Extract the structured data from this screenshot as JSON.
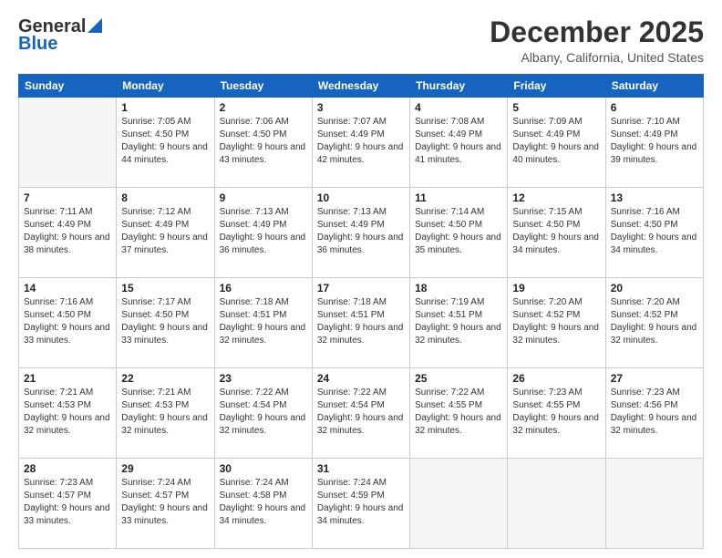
{
  "logo": {
    "general": "General",
    "blue": "Blue"
  },
  "header": {
    "month": "December 2025",
    "location": "Albany, California, United States"
  },
  "days_of_week": [
    "Sunday",
    "Monday",
    "Tuesday",
    "Wednesday",
    "Thursday",
    "Friday",
    "Saturday"
  ],
  "weeks": [
    [
      {
        "num": "",
        "empty": true
      },
      {
        "num": "1",
        "sunrise": "7:05 AM",
        "sunset": "4:50 PM",
        "daylight": "9 hours and 44 minutes."
      },
      {
        "num": "2",
        "sunrise": "7:06 AM",
        "sunset": "4:50 PM",
        "daylight": "9 hours and 43 minutes."
      },
      {
        "num": "3",
        "sunrise": "7:07 AM",
        "sunset": "4:49 PM",
        "daylight": "9 hours and 42 minutes."
      },
      {
        "num": "4",
        "sunrise": "7:08 AM",
        "sunset": "4:49 PM",
        "daylight": "9 hours and 41 minutes."
      },
      {
        "num": "5",
        "sunrise": "7:09 AM",
        "sunset": "4:49 PM",
        "daylight": "9 hours and 40 minutes."
      },
      {
        "num": "6",
        "sunrise": "7:10 AM",
        "sunset": "4:49 PM",
        "daylight": "9 hours and 39 minutes."
      }
    ],
    [
      {
        "num": "7",
        "sunrise": "7:11 AM",
        "sunset": "4:49 PM",
        "daylight": "9 hours and 38 minutes."
      },
      {
        "num": "8",
        "sunrise": "7:12 AM",
        "sunset": "4:49 PM",
        "daylight": "9 hours and 37 minutes."
      },
      {
        "num": "9",
        "sunrise": "7:13 AM",
        "sunset": "4:49 PM",
        "daylight": "9 hours and 36 minutes."
      },
      {
        "num": "10",
        "sunrise": "7:13 AM",
        "sunset": "4:49 PM",
        "daylight": "9 hours and 36 minutes."
      },
      {
        "num": "11",
        "sunrise": "7:14 AM",
        "sunset": "4:50 PM",
        "daylight": "9 hours and 35 minutes."
      },
      {
        "num": "12",
        "sunrise": "7:15 AM",
        "sunset": "4:50 PM",
        "daylight": "9 hours and 34 minutes."
      },
      {
        "num": "13",
        "sunrise": "7:16 AM",
        "sunset": "4:50 PM",
        "daylight": "9 hours and 34 minutes."
      }
    ],
    [
      {
        "num": "14",
        "sunrise": "7:16 AM",
        "sunset": "4:50 PM",
        "daylight": "9 hours and 33 minutes."
      },
      {
        "num": "15",
        "sunrise": "7:17 AM",
        "sunset": "4:50 PM",
        "daylight": "9 hours and 33 minutes."
      },
      {
        "num": "16",
        "sunrise": "7:18 AM",
        "sunset": "4:51 PM",
        "daylight": "9 hours and 32 minutes."
      },
      {
        "num": "17",
        "sunrise": "7:18 AM",
        "sunset": "4:51 PM",
        "daylight": "9 hours and 32 minutes."
      },
      {
        "num": "18",
        "sunrise": "7:19 AM",
        "sunset": "4:51 PM",
        "daylight": "9 hours and 32 minutes."
      },
      {
        "num": "19",
        "sunrise": "7:20 AM",
        "sunset": "4:52 PM",
        "daylight": "9 hours and 32 minutes."
      },
      {
        "num": "20",
        "sunrise": "7:20 AM",
        "sunset": "4:52 PM",
        "daylight": "9 hours and 32 minutes."
      }
    ],
    [
      {
        "num": "21",
        "sunrise": "7:21 AM",
        "sunset": "4:53 PM",
        "daylight": "9 hours and 32 minutes."
      },
      {
        "num": "22",
        "sunrise": "7:21 AM",
        "sunset": "4:53 PM",
        "daylight": "9 hours and 32 minutes."
      },
      {
        "num": "23",
        "sunrise": "7:22 AM",
        "sunset": "4:54 PM",
        "daylight": "9 hours and 32 minutes."
      },
      {
        "num": "24",
        "sunrise": "7:22 AM",
        "sunset": "4:54 PM",
        "daylight": "9 hours and 32 minutes."
      },
      {
        "num": "25",
        "sunrise": "7:22 AM",
        "sunset": "4:55 PM",
        "daylight": "9 hours and 32 minutes."
      },
      {
        "num": "26",
        "sunrise": "7:23 AM",
        "sunset": "4:55 PM",
        "daylight": "9 hours and 32 minutes."
      },
      {
        "num": "27",
        "sunrise": "7:23 AM",
        "sunset": "4:56 PM",
        "daylight": "9 hours and 32 minutes."
      }
    ],
    [
      {
        "num": "28",
        "sunrise": "7:23 AM",
        "sunset": "4:57 PM",
        "daylight": "9 hours and 33 minutes."
      },
      {
        "num": "29",
        "sunrise": "7:24 AM",
        "sunset": "4:57 PM",
        "daylight": "9 hours and 33 minutes."
      },
      {
        "num": "30",
        "sunrise": "7:24 AM",
        "sunset": "4:58 PM",
        "daylight": "9 hours and 34 minutes."
      },
      {
        "num": "31",
        "sunrise": "7:24 AM",
        "sunset": "4:59 PM",
        "daylight": "9 hours and 34 minutes."
      },
      {
        "num": "",
        "empty": true
      },
      {
        "num": "",
        "empty": true
      },
      {
        "num": "",
        "empty": true
      }
    ]
  ],
  "labels": {
    "sunrise": "Sunrise:",
    "sunset": "Sunset:",
    "daylight": "Daylight:"
  }
}
